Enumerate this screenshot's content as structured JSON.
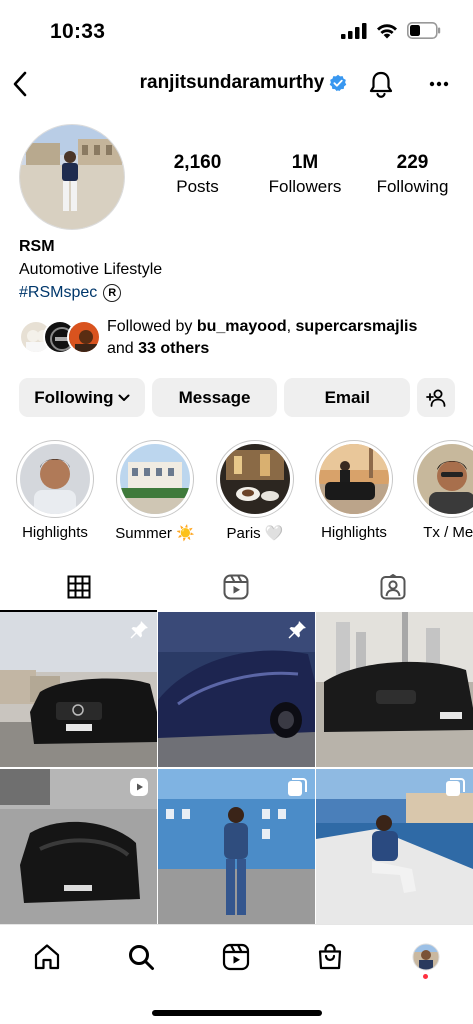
{
  "status_bar": {
    "time": "10:33"
  },
  "header": {
    "username": "ranjitsundaramurthy",
    "verified_icon": "verified-badge-icon"
  },
  "stats": [
    {
      "number": "2,160",
      "label": "Posts"
    },
    {
      "number": "1M",
      "label": "Followers"
    },
    {
      "number": "229",
      "label": "Following"
    }
  ],
  "bio": {
    "name": "RSM",
    "category": "Automotive Lifestyle",
    "hashtag": "#RSMspec",
    "registered_mark": "R"
  },
  "followed_by": {
    "prefix": "Followed by ",
    "user1": "bu_mayood",
    "separator": ", ",
    "user2": "supercarsmajlis",
    "and": "and ",
    "others": "33 others"
  },
  "actions": {
    "following": "Following",
    "message": "Message",
    "email": "Email"
  },
  "highlights": [
    {
      "label": "Highlights"
    },
    {
      "label": "Summer ☀️"
    },
    {
      "label": "Paris 🤍"
    },
    {
      "label": "Highlights"
    },
    {
      "label": "Tx  / Mex"
    }
  ],
  "colors": {
    "verified": "#3897f0",
    "button_bg": "#efefef",
    "link": "#00376b",
    "notification_dot": "#ff3040"
  }
}
